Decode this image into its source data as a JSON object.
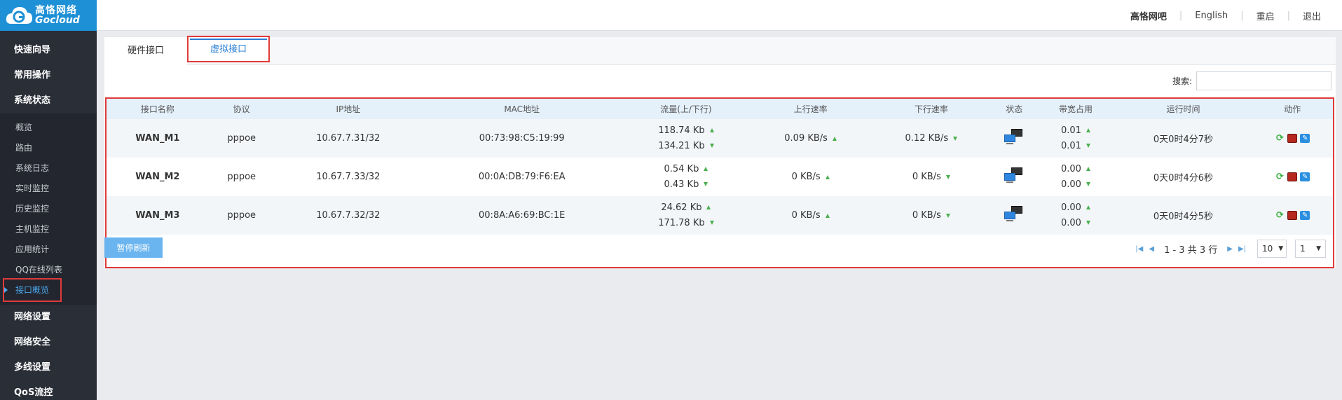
{
  "brand": {
    "name_cn": "高恪网络",
    "name_en": "Gocloud"
  },
  "topbar": {
    "links": [
      "高恪网吧",
      "English",
      "重启",
      "退出"
    ]
  },
  "sidebar": {
    "groups_top": [
      "快速向导",
      "常用操作",
      "系统状态"
    ],
    "status_items": [
      "概览",
      "路由",
      "系统日志",
      "实时监控",
      "历史监控",
      "主机监控",
      "应用统计",
      "QQ在线列表",
      "接口概览"
    ],
    "groups_bottom": [
      "网络设置",
      "网络安全",
      "多线设置",
      "QoS流控"
    ]
  },
  "tabs": [
    "硬件接口",
    "虚拟接口"
  ],
  "search": {
    "label": "搜索:",
    "value": ""
  },
  "table": {
    "headers": [
      "接口名称",
      "协议",
      "IP地址",
      "MAC地址",
      "流量(上/下行)",
      "上行速率",
      "下行速率",
      "状态",
      "带宽占用",
      "运行时间",
      "动作"
    ],
    "rows": [
      {
        "name": "WAN_M1",
        "proto": "pppoe",
        "ip": "10.67.7.31/32",
        "mac": "00:73:98:C5:19:99",
        "flow_up": "118.74 Kb",
        "flow_down": "134.21 Kb",
        "up_rate": "0.09 KB/s",
        "down_rate": "0.12 KB/s",
        "bw_up": "0.01",
        "bw_down": "0.01",
        "uptime": "0天0时4分7秒"
      },
      {
        "name": "WAN_M2",
        "proto": "pppoe",
        "ip": "10.67.7.33/32",
        "mac": "00:0A:DB:79:F6:EA",
        "flow_up": "0.54 Kb",
        "flow_down": "0.43 Kb",
        "up_rate": "0 KB/s",
        "down_rate": "0 KB/s",
        "bw_up": "0.00",
        "bw_down": "0.00",
        "uptime": "0天0时4分6秒"
      },
      {
        "name": "WAN_M3",
        "proto": "pppoe",
        "ip": "10.67.7.32/32",
        "mac": "00:8A:A6:69:BC:1E",
        "flow_up": "24.62 Kb",
        "flow_down": "171.78 Kb",
        "up_rate": "0 KB/s",
        "down_rate": "0 KB/s",
        "bw_up": "0.00",
        "bw_down": "0.00",
        "uptime": "0天0时4分5秒"
      }
    ]
  },
  "footer": {
    "pause_label": "暂停刷新",
    "range_text": "1 - 3 共 3 行",
    "page_size": "10",
    "page": "1"
  },
  "icons": {
    "status": "network-computers-icon",
    "refresh": "refresh-icon",
    "disconnect": "disconnect-icon",
    "edit": "edit-icon"
  }
}
